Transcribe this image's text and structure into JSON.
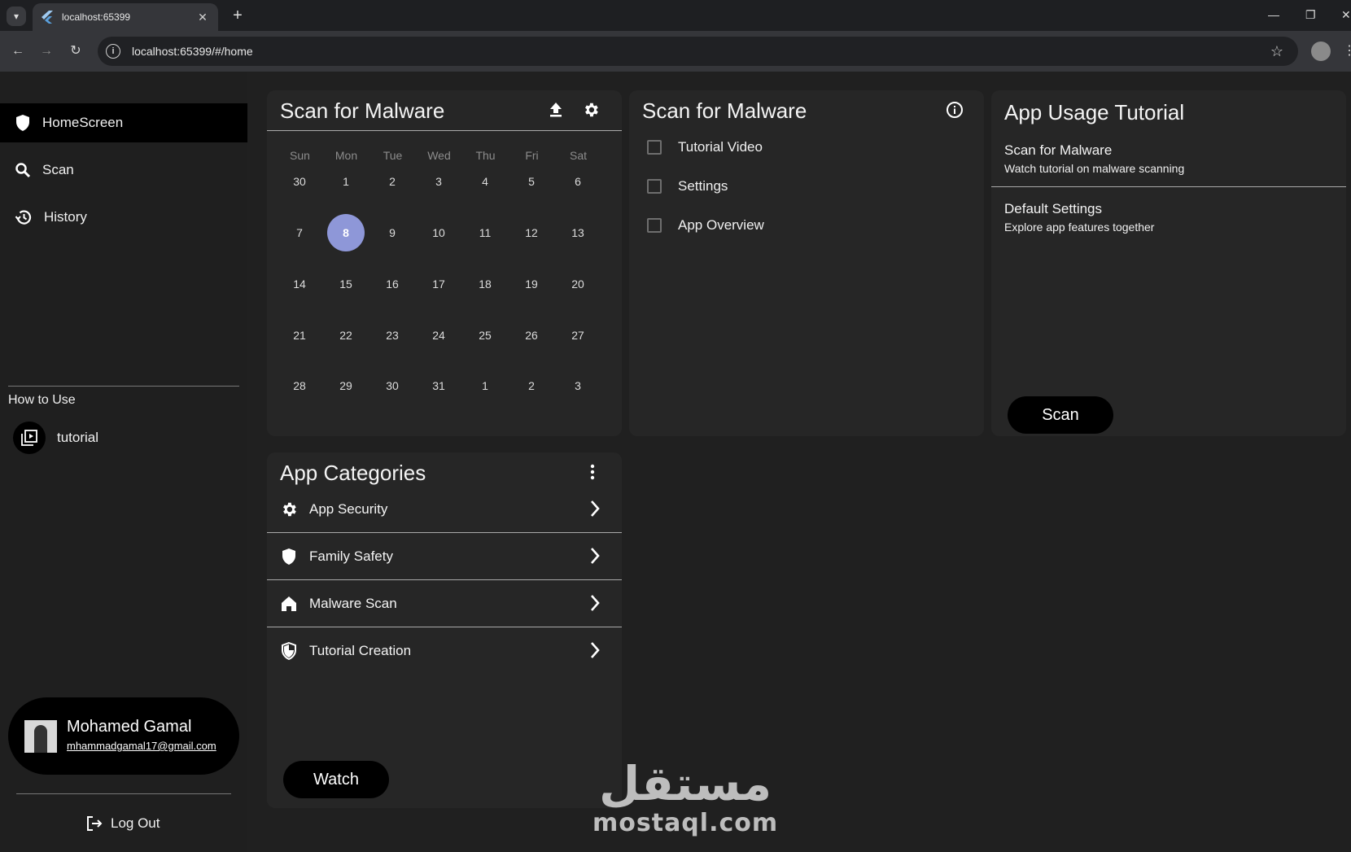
{
  "browser": {
    "tab_title": "localhost:65399",
    "url": "localhost:65399/#/home"
  },
  "sidebar": {
    "items": [
      {
        "label": "HomeScreen"
      },
      {
        "label": "Scan"
      },
      {
        "label": "History"
      }
    ],
    "section_label": "How to Use",
    "tutorial_label": "tutorial",
    "user": {
      "name": "Mohamed Gamal",
      "email": "mhammadgamal17@gmail.com"
    },
    "logout_label": "Log Out"
  },
  "calendar_card": {
    "title": "Scan for Malware",
    "weekdays": [
      "Sun",
      "Mon",
      "Tue",
      "Wed",
      "Thu",
      "Fri",
      "Sat"
    ],
    "weeks": [
      [
        "30",
        "1",
        "2",
        "3",
        "4",
        "5",
        "6"
      ],
      [
        "7",
        "8",
        "9",
        "10",
        "11",
        "12",
        "13"
      ],
      [
        "14",
        "15",
        "16",
        "17",
        "18",
        "19",
        "20"
      ],
      [
        "21",
        "22",
        "23",
        "24",
        "25",
        "26",
        "27"
      ],
      [
        "28",
        "29",
        "30",
        "31",
        "1",
        "2",
        "3"
      ]
    ],
    "selected_day": "8",
    "selected_color": "#8e97d8"
  },
  "checklist_card": {
    "title": "Scan for Malware",
    "items": [
      "Tutorial Video",
      "Settings",
      "App Overview"
    ]
  },
  "tutorial_card": {
    "title": "App Usage Tutorial",
    "rows": [
      {
        "title": "Scan for Malware",
        "subtitle": "Watch tutorial on malware scanning"
      },
      {
        "title": "Default Settings",
        "subtitle": "Explore app features together"
      }
    ],
    "button_label": "Scan"
  },
  "categories_card": {
    "title": "App Categories",
    "items": [
      {
        "label": "App Security",
        "icon": "gear-icon"
      },
      {
        "label": "Family Safety",
        "icon": "shield-icon"
      },
      {
        "label": "Malware Scan",
        "icon": "home-icon"
      },
      {
        "label": "Tutorial Creation",
        "icon": "security-shield-icon"
      }
    ],
    "button_label": "Watch"
  },
  "watermark": {
    "arabic": "مستقل",
    "latin": "mostaql.com"
  }
}
